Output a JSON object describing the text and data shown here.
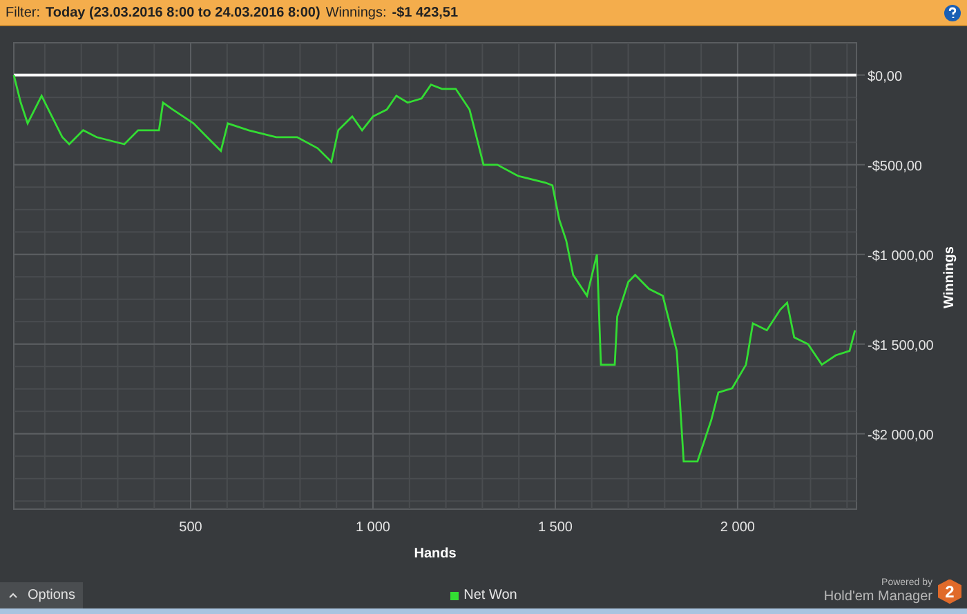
{
  "filter_bar": {
    "label": "Filter:",
    "value": "Today (23.03.2016 8:00 to 24.03.2016 8:00)",
    "winnings_label": "Winnings:",
    "winnings_value": "-$1 423,51"
  },
  "chart": {
    "chart_data": {
      "type": "line",
      "grid": true,
      "xlabel": "Hands",
      "ylabel": "Winnings",
      "xlim": [
        15,
        2326
      ],
      "ylim": [
        -2420,
        180
      ],
      "xticks": [
        {
          "value": 500,
          "label": "500"
        },
        {
          "value": 1000,
          "label": "1 000"
        },
        {
          "value": 1500,
          "label": "1 500"
        },
        {
          "value": 2000,
          "label": "2 000"
        }
      ],
      "yticks": [
        {
          "value": 0,
          "label": "$0,00"
        },
        {
          "value": -500,
          "label": "-$500,00"
        },
        {
          "value": -1000,
          "label": "-$1 000,00"
        },
        {
          "value": -1500,
          "label": "-$1 500,00"
        },
        {
          "value": -2000,
          "label": "-$2 000,00"
        }
      ],
      "x": [
        15,
        34,
        53,
        91,
        110,
        148,
        167,
        205,
        242,
        318,
        356,
        413,
        424,
        451,
        508,
        545,
        583,
        602,
        659,
        735,
        792,
        848,
        886,
        905,
        943,
        970,
        1000,
        1038,
        1064,
        1095,
        1133,
        1159,
        1189,
        1227,
        1265,
        1284,
        1303,
        1341,
        1398,
        1473,
        1492,
        1511,
        1530,
        1549,
        1587,
        1614,
        1625,
        1663,
        1670,
        1700,
        1719,
        1757,
        1795,
        1833,
        1852,
        1890,
        1928,
        1947,
        1985,
        2023,
        2042,
        2080,
        2117,
        2136,
        2155,
        2193,
        2231,
        2269,
        2307,
        2322
      ],
      "series": [
        {
          "name": "Net Won",
          "color": "#33dd33",
          "values": [
            0,
            -154,
            -269,
            -115,
            -192,
            -346,
            -385,
            -308,
            -346,
            -385,
            -308,
            -308,
            -154,
            -192,
            -269,
            -346,
            -423,
            -269,
            -308,
            -346,
            -346,
            -408,
            -485,
            -308,
            -231,
            -308,
            -231,
            -192,
            -115,
            -154,
            -131,
            -54,
            -77,
            -77,
            -192,
            -346,
            -500,
            -500,
            -562,
            -600,
            -615,
            -808,
            -923,
            -1115,
            -1231,
            -1000,
            -1615,
            -1615,
            -1346,
            -1154,
            -1115,
            -1192,
            -1231,
            -1538,
            -2154,
            -2154,
            -1923,
            -1769,
            -1746,
            -1615,
            -1385,
            -1423,
            -1308,
            -1269,
            -1462,
            -1500,
            -1615,
            -1562,
            -1538,
            -1423
          ]
        }
      ]
    }
  },
  "footer": {
    "options_button": "Options",
    "powered_by": "Powered by",
    "brand": "Hold'em Manager",
    "brand_badge": "2"
  }
}
